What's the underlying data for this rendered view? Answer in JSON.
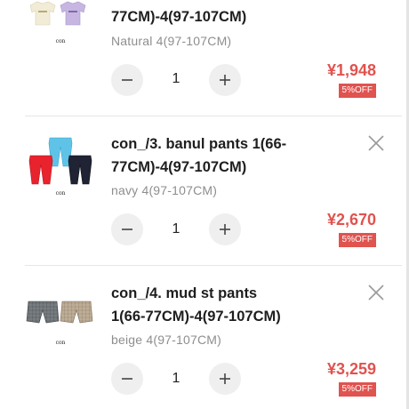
{
  "cart": {
    "items": [
      {
        "title": "77CM)-4(97-107CM)",
        "variant": "Natural 4(97-107CM)",
        "quantity": "1",
        "price": "¥1,948",
        "discount": "5%OFF",
        "thumb_caption": "con"
      },
      {
        "title": "con_/3. banul pants 1(66-77CM)-4(97-107CM)",
        "variant": "navy 4(97-107CM)",
        "quantity": "1",
        "price": "¥2,670",
        "discount": "5%OFF",
        "thumb_caption": "con"
      },
      {
        "title": "con_/4. mud st pants 1(66-77CM)-4(97-107CM)",
        "variant": "beige 4(97-107CM)",
        "quantity": "1",
        "price": "¥3,259",
        "discount": "5%OFF",
        "thumb_caption": "con"
      }
    ]
  },
  "icons": {
    "remove": "close-icon",
    "decrease": "minus-icon",
    "increase": "plus-icon"
  },
  "colors": {
    "price": "#e0534f",
    "badge_bg": "#e0534f",
    "variant_text": "#8e8e8e",
    "qty_button_bg": "#efefef"
  }
}
